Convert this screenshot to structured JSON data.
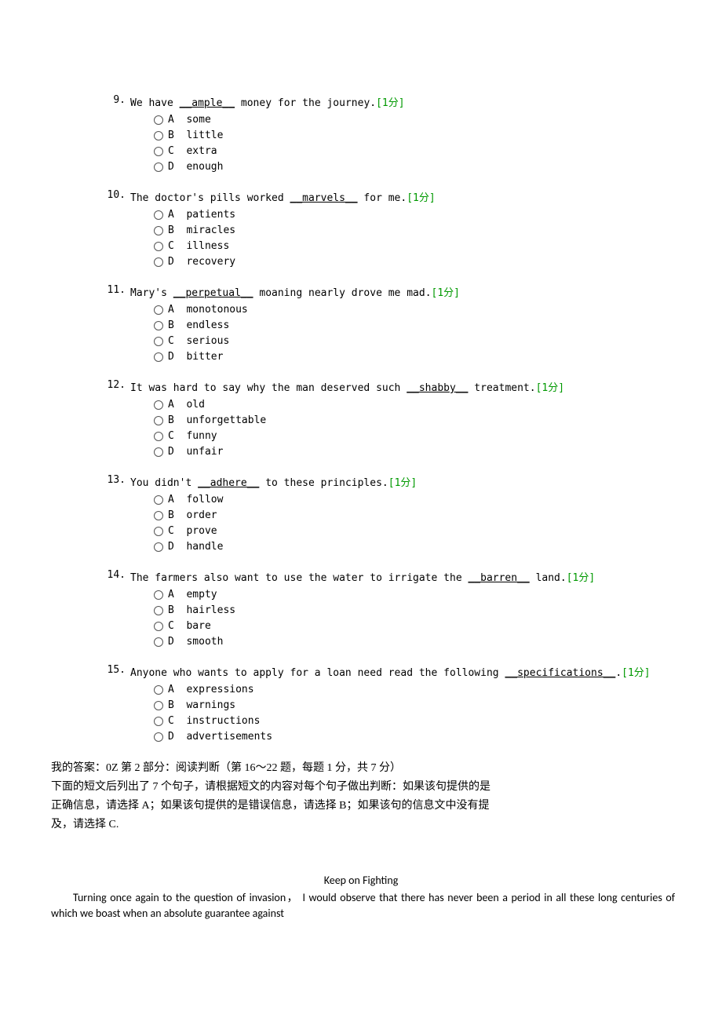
{
  "questions": [
    {
      "num": "9.",
      "before": "We have ",
      "underlined": "__ample__",
      "after": " money for the journey.",
      "points": "[1分]",
      "options": [
        "A  some",
        "B  little",
        "C  extra",
        "D  enough"
      ]
    },
    {
      "num": "10.",
      "before": "The doctor's pills worked ",
      "underlined": "__marvels__",
      "after": " for me.",
      "points": "[1分]",
      "options": [
        "A  patients",
        "B  miracles",
        "C  illness",
        "D  recovery"
      ]
    },
    {
      "num": "11.",
      "before": "Mary's ",
      "underlined": "__perpetual__",
      "after": " moaning nearly drove me mad.",
      "points": "[1分]",
      "options": [
        "A  monotonous",
        "B  endless",
        "C  serious",
        "D  bitter"
      ]
    },
    {
      "num": "12.",
      "before": "It was hard to say why the man deserved such ",
      "underlined": "__shabby__",
      "after": " treatment.",
      "points": "[1分]",
      "options": [
        "A  old",
        "B  unforgettable",
        "C  funny",
        "D  unfair"
      ]
    },
    {
      "num": "13.",
      "before": "You didn't ",
      "underlined": "__adhere__",
      "after": " to these principles.",
      "points": "[1分]",
      "options": [
        "A  follow",
        "B  order",
        "C  prove",
        "D  handle"
      ]
    },
    {
      "num": "14.",
      "before": "The farmers also want to use the water to irrigate the ",
      "underlined": "__barren__",
      "after": " land.",
      "points": "[1分]",
      "options": [
        "A  empty",
        "B  hairless",
        "C  bare",
        "D  smooth"
      ]
    },
    {
      "num": "15.",
      "before": "Anyone who wants to apply for a loan need read the following ",
      "underlined": "__specifications__",
      "after": ".",
      "points": "[1分]",
      "options": [
        "A  expressions",
        "B  warnings",
        "C  instructions",
        "D  advertisements"
      ]
    }
  ],
  "answer_line": "我的答案：0Z 第 2 部分：阅读判断（第 16～22 题，每题 1 分，共 7 分）",
  "instructions_l1": "下面的短文后列出了 7 个句子，请根据短文的内容对每个句子做出判断：如果该句提供的是",
  "instructions_l2": "正确信息，请选择 A；如果该句提供的是错误信息，请选择 B；如果该句的信息文中没有提",
  "instructions_l3": "及，请选择 C.",
  "passage": {
    "title": "Keep on Fighting",
    "body": "Turning once again to the question of invasion，  I would observe that there has never been a period in all these long centuries of which we boast when an absolute guarantee against"
  }
}
